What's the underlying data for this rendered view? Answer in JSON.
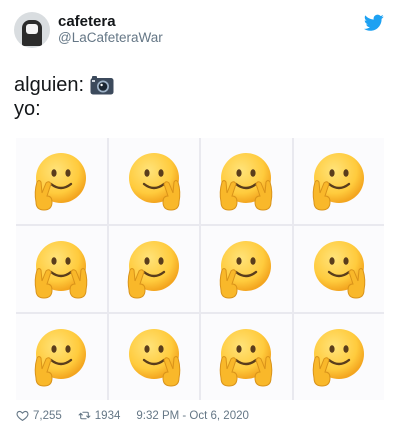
{
  "user": {
    "display_name": "cafetera",
    "handle": "@LaCafeteraWar"
  },
  "tweet": {
    "line1": "alguien:",
    "line2": "yo:"
  },
  "icons": {
    "logo": "twitter-bird-icon",
    "camera": "camera-icon",
    "like": "heart-icon",
    "retweet": "retweet-icon",
    "emoji": "smiling-face-peace-sign-emoji"
  },
  "grid": {
    "rows": 3,
    "cols": 4,
    "cells": [
      {
        "hand": "left"
      },
      {
        "hand": "right"
      },
      {
        "hand": "both"
      },
      {
        "hand": "left"
      },
      {
        "hand": "both"
      },
      {
        "hand": "left"
      },
      {
        "hand": "left"
      },
      {
        "hand": "right"
      },
      {
        "hand": "left"
      },
      {
        "hand": "right"
      },
      {
        "hand": "both"
      },
      {
        "hand": "left"
      }
    ]
  },
  "stats": {
    "likes": "7,255",
    "retweets": "1934",
    "timestamp": "9:32 PM - Oct 6, 2020"
  },
  "colors": {
    "twitter_blue": "#1da1f2",
    "emoji_yellow": "#ffcb3d",
    "meta_gray": "#657786"
  }
}
